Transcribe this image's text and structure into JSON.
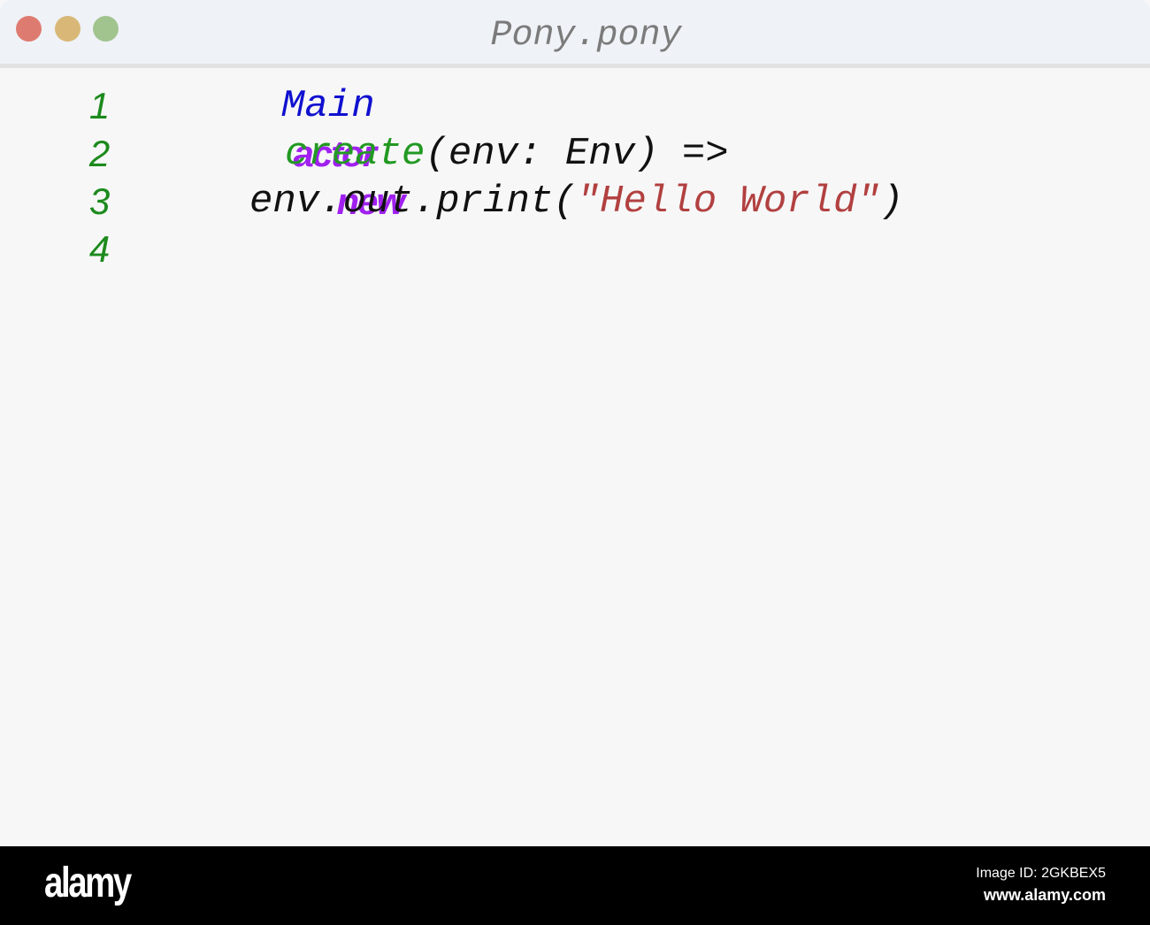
{
  "window": {
    "title": "Pony.pony",
    "controls": [
      {
        "name": "close",
        "color": "#de7b70"
      },
      {
        "name": "minimize",
        "color": "#d9b877"
      },
      {
        "name": "maximize",
        "color": "#a1c48f"
      }
    ]
  },
  "editor": {
    "lines": [
      {
        "number": "1",
        "tokens": [
          "actor",
          "Main"
        ]
      },
      {
        "number": "2",
        "tokens": [
          "new",
          "create",
          "(env: Env) =>"
        ]
      },
      {
        "number": "3",
        "tokens": [
          "env.out.print(",
          "\"Hello World\"",
          ")"
        ]
      },
      {
        "number": "4",
        "tokens": []
      }
    ]
  },
  "footer": {
    "logo": "alamy",
    "image_id": "Image ID: 2GKBEX5",
    "url": "www.alamy.com"
  }
}
